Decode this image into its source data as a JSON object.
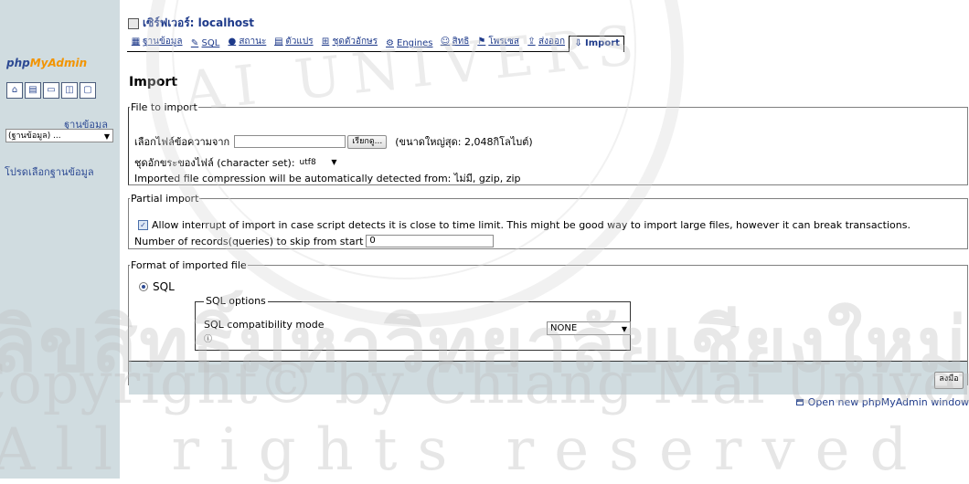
{
  "left": {
    "logo": {
      "php": "php",
      "my": "My",
      "admin": "Admin"
    },
    "icons": [
      "home-icon",
      "database-icon",
      "sql-window-icon",
      "query-icon",
      "docs-icon"
    ],
    "db_label": "ฐานข้อมูล",
    "db_select": "(ฐานข้อมูล) ...",
    "choose_db": "โปรดเลือกฐานข้อมูล"
  },
  "header": {
    "server_label": "เซิร์ฟเวอร์: localhost"
  },
  "tabs": [
    {
      "label": "ฐานข้อมูล",
      "icon": "database-icon"
    },
    {
      "label": "SQL",
      "icon": "sql-icon"
    },
    {
      "label": "สถานะ",
      "icon": "status-icon"
    },
    {
      "label": "ตัวแปร",
      "icon": "variables-icon"
    },
    {
      "label": "ชุดตัวอักษร",
      "icon": "charset-icon"
    },
    {
      "label": "Engines",
      "icon": "engines-icon"
    },
    {
      "label": "สิทธิ",
      "icon": "privileges-icon"
    },
    {
      "label": "โพรเซส",
      "icon": "processes-icon"
    },
    {
      "label": "ส่งออก",
      "icon": "export-icon"
    },
    {
      "label": "Import",
      "icon": "import-icon",
      "active": true
    }
  ],
  "page_title": "Import",
  "file_to_import": {
    "legend": "File to import",
    "file_label": "เลือกไฟล์ข้อความจาก",
    "browse_button": "เรียกดู...",
    "max_size": "(ขนาดใหญ่สุด: 2,048กิโลไบต์)",
    "charset_label": "ชุดอักขระของไฟล์ (character set):",
    "charset_value": "utf8",
    "compression_note": "Imported file compression will be automatically detected from: ไม่มี, gzip, zip"
  },
  "partial_import": {
    "legend": "Partial import",
    "interrupt_label": "Allow interrupt of import in case script detects it is close to time limit. This might be good way to import large files, however it can break transactions.",
    "interrupt_checked": true,
    "skip_label": "Number of records(queries) to skip from start",
    "skip_value": "0"
  },
  "format": {
    "legend": "Format of imported file",
    "sql_radio_label": "SQL",
    "sql_options_legend": "SQL options",
    "compat_label": "SQL compatibility mode",
    "compat_value": "NONE"
  },
  "go_button": "ลงมือ",
  "new_window_link": "Open new phpMyAdmin window",
  "watermark": {
    "ring_text": "AI UNIVERS",
    "thai": "ลิขสิทธิ์มหาวิทยาลัยเชียงใหม่",
    "copyright": "Copyright© by Chiang Mai University",
    "rights": "All rights reserved"
  }
}
